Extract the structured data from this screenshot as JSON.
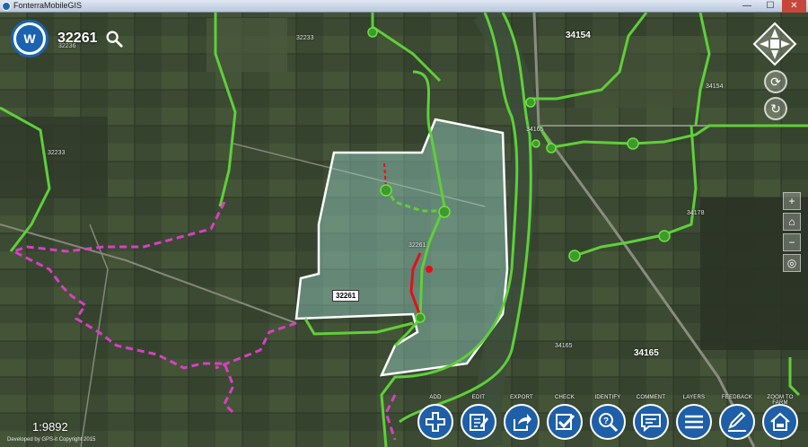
{
  "window": {
    "title": "FonterraMobileGIS",
    "min": "—",
    "max": "☐",
    "close": "✕"
  },
  "header": {
    "logo_letter": "W",
    "farm_id": "32261"
  },
  "map_labels": {
    "l32233a": "32233",
    "l32236": "32236",
    "l32233b": "32233",
    "l34154big": "34154",
    "l34154": "34154",
    "l34165a": "34165",
    "l34178": "34178",
    "l32261": "32261",
    "l34165b": "34165",
    "l34165big": "34165"
  },
  "parcel_tag": "32261",
  "scale": "1:9892",
  "credit": "Developed by GPS-it Copyright 2015",
  "nav": {
    "refresh": "⟳",
    "rotate": "↻",
    "zoom_in": "+",
    "home": "⌂",
    "zoom_out": "−",
    "locate": "◎"
  },
  "toolbar": [
    {
      "label": "ADD",
      "icon": "add-icon"
    },
    {
      "label": "EDIT",
      "icon": "edit-icon"
    },
    {
      "label": "EXPORT",
      "icon": "export-icon"
    },
    {
      "label": "CHECK",
      "icon": "check-icon"
    },
    {
      "label": "IDENTIFY",
      "icon": "identify-icon"
    },
    {
      "label": "COMMENT",
      "icon": "comment-icon"
    },
    {
      "label": "LAYERS",
      "icon": "layers-icon"
    },
    {
      "label": "FEEDBACK",
      "icon": "feedback-icon"
    },
    {
      "label": "ZOOM TO FARM",
      "icon": "home-icon"
    }
  ],
  "colors": {
    "accent": "#1e5fa8",
    "race_green": "#5fcf3a",
    "boundary_magenta": "#d93fc4",
    "red_route": "#e0121b"
  }
}
